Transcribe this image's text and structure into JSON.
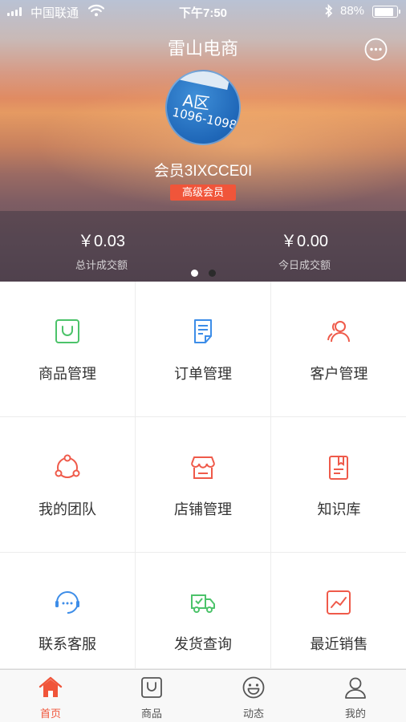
{
  "status_bar": {
    "carrier": "中国联通",
    "wifi_icon": "wifi-icon",
    "time": "下午7:50",
    "bluetooth_icon": "bluetooth-icon",
    "battery_percent": "88%",
    "battery_level": 0.88
  },
  "header": {
    "title": "雷山电商",
    "chat_icon": "chat-bubble-icon"
  },
  "profile": {
    "avatar_text_zone": "A区",
    "avatar_text_number": "1096-1098",
    "member_name": "会员3IXCCE0I",
    "member_level": "高级会员"
  },
  "stats": {
    "total_value": "￥0.03",
    "total_label": "总计成交额",
    "today_value": "￥0.00",
    "today_label": "今日成交额",
    "page_count": 2,
    "active_page": 1
  },
  "menu": [
    {
      "label": "商品管理",
      "icon": "shopping-bag-icon",
      "color": "#4cc36a"
    },
    {
      "label": "订单管理",
      "icon": "order-document-icon",
      "color": "#3d8de8"
    },
    {
      "label": "客户管理",
      "icon": "customers-icon",
      "color": "#ef5a4a"
    },
    {
      "label": "我的团队",
      "icon": "team-network-icon",
      "color": "#ef5a4a"
    },
    {
      "label": "店铺管理",
      "icon": "storefront-icon",
      "color": "#ef5a4a"
    },
    {
      "label": "知识库",
      "icon": "knowledge-book-icon",
      "color": "#ef5a4a"
    },
    {
      "label": "联系客服",
      "icon": "customer-service-icon",
      "color": "#3d8de8"
    },
    {
      "label": "发货查询",
      "icon": "delivery-truck-icon",
      "color": "#4cc36a"
    },
    {
      "label": "最近销售",
      "icon": "sales-chart-icon",
      "color": "#ef5a4a"
    }
  ],
  "tabbar": [
    {
      "label": "首页",
      "icon": "home-icon",
      "active": true
    },
    {
      "label": "商品",
      "icon": "shopping-bag-icon",
      "active": false
    },
    {
      "label": "动态",
      "icon": "smiley-icon",
      "active": false
    },
    {
      "label": "我的",
      "icon": "user-icon",
      "active": false
    }
  ],
  "colors": {
    "accent": "#f0553a",
    "grid_divider": "#ececec"
  }
}
